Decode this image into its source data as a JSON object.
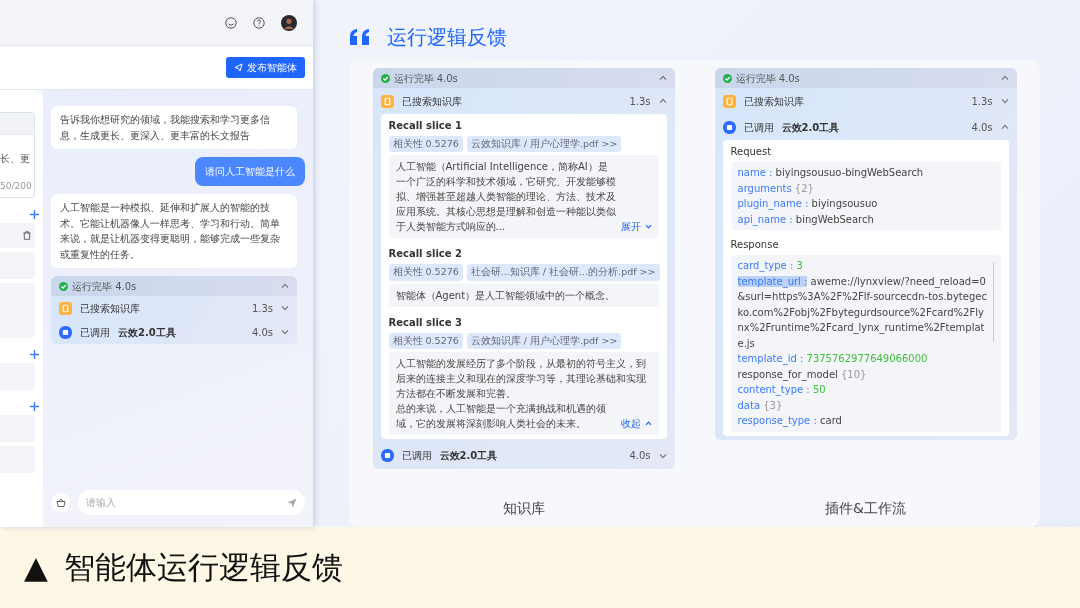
{
  "assistant_app": {
    "publish_button": "发布智能体",
    "sidebar": {
      "text_fragment": "长、更",
      "counter": "50/200"
    },
    "messages": [
      {
        "kind": "bot",
        "text": "告诉我你想研究的领域，我能搜索和学习更多信息，生成更长、更深入、更丰富的长文报告"
      },
      {
        "kind": "user",
        "text": "请问人工智能是什么"
      },
      {
        "kind": "bot",
        "text": "人工智能是一种模拟、延伸和扩展人的智能的技术。它能让机器像人一样思考、学习和行动。简单来说，就是让机器变得更聪明，能够完成一些复杂或重复性的任务。"
      }
    ],
    "run_log": {
      "status": "运行完毕 4.0s",
      "expanded": true,
      "steps": [
        {
          "kind": "knowledge",
          "label": "已搜索知识库",
          "time": "1.3s",
          "expanded": false
        },
        {
          "kind": "tool",
          "label": "已调用",
          "tool": "云效2.0工具",
          "time": "4.0s",
          "expanded": false
        }
      ]
    },
    "input": {
      "placeholder": "请输入"
    }
  },
  "section": {
    "title": "运行逻辑反馈"
  },
  "examples": [
    {
      "caption": "知识库",
      "run_log": {
        "status": "运行完毕 4.0s",
        "expanded": true,
        "steps": [
          {
            "kind": "knowledge",
            "label": "已搜索知识库",
            "time": "1.3s",
            "expanded": true,
            "slices": [
              {
                "title": "Recall slice 1",
                "tags": [
                  "相关性 0.5276",
                  "云效知识库 / 用户心理学.pdf >>"
                ],
                "paragraphs": [
                  "人工智能（Artificial Intelligence，简称AI）是一个广泛的科学和技术领域，它研究、开发能够模拟、增强甚至超越人类智能的理论、方法、技术及应用系统。其核心思想是理解和创造一种能以类似于人类智能方式响应的..."
                ],
                "toggle": {
                  "label": "展开",
                  "expanded": false
                }
              },
              {
                "title": "Recall slice 2",
                "tags": [
                  "相关性 0.5276",
                  "社会研...知识库 / 社会研...的分析.pdf >>"
                ],
                "paragraphs": [
                  "智能体（Agent）是人工智能领域中的一个概念。"
                ]
              },
              {
                "title": "Recall slice 3",
                "tags": [
                  "相关性 0.5276",
                  "云效知识库 / 用户心理学.pdf >>"
                ],
                "paragraphs": [
                  "人工智能的发展经历了多个阶段，从最初的符号主义，到后来的连接主义和现在的深度学习等，其理论基础和实现方法都在不断发展和完善。",
                  "总的来说，人工智能是一个充满挑战和机遇的领域，它的发展将深刻影响人类社会的未来。"
                ],
                "toggle": {
                  "label": "收起",
                  "expanded": true
                }
              }
            ]
          },
          {
            "kind": "tool",
            "label": "已调用",
            "tool": "云效2.0工具",
            "time": "4.0s",
            "expanded": false
          }
        ]
      }
    },
    {
      "caption": "插件&工作流",
      "run_log": {
        "status": "运行完毕 4.0s",
        "expanded": true,
        "steps": [
          {
            "kind": "knowledge",
            "label": "已搜索知识库",
            "time": "1.3s",
            "expanded": false
          },
          {
            "kind": "tool",
            "label": "已调用",
            "tool": "云效2.0工具",
            "time": "4.0s",
            "expanded": true,
            "request_label": "Request",
            "request": [
              {
                "key": "name :",
                "value": "biyingsousuo-bingWebSearch",
                "kind": "string",
                "plain_key": false,
                "highlighted": false
              },
              {
                "key": "arguments",
                "value": "{2}",
                "kind": "object",
                "plain_key": false,
                "highlighted": false
              },
              {
                "key": "plugin_name :",
                "value": "biyingsousuo",
                "kind": "string",
                "plain_key": false,
                "highlighted": false
              },
              {
                "key": "api_name :",
                "value": "bingWebSearch",
                "kind": "string",
                "plain_key": false,
                "highlighted": false
              }
            ],
            "response_label": "Response",
            "response": [
              {
                "key": "card_type :",
                "value": "3",
                "kind": "number",
                "plain_key": false,
                "highlighted": false
              },
              {
                "key": "template_url :",
                "value": "aweme://lynxview/?need_reload=0&surl=https%3A%2F%2Flf-sourcecdn-tos.bytegecko.com%2Fobj%2Fbytegurdsource%2Fcard%2Flynx%2Fruntime%2Fcard_lynx_runtime%2Ftemplate.js",
                "kind": "string",
                "plain_key": false,
                "highlighted": true
              },
              {
                "key": "template_id :",
                "value": "7375762977649066000",
                "kind": "number",
                "plain_key": false,
                "highlighted": false
              },
              {
                "key": "response_for_model",
                "value": "{10}",
                "kind": "object",
                "plain_key": true,
                "highlighted": false
              },
              {
                "key": "content_type :",
                "value": "50",
                "kind": "number",
                "plain_key": false,
                "highlighted": false
              },
              {
                "key": "data",
                "value": "{3}",
                "kind": "object",
                "plain_key": false,
                "highlighted": false
              },
              {
                "key": "response_type :",
                "value": "card",
                "kind": "string",
                "plain_key": false,
                "highlighted": false
              }
            ]
          }
        ]
      }
    }
  ],
  "footer": {
    "marker": "▲",
    "title": "智能体运行逻辑反馈"
  }
}
